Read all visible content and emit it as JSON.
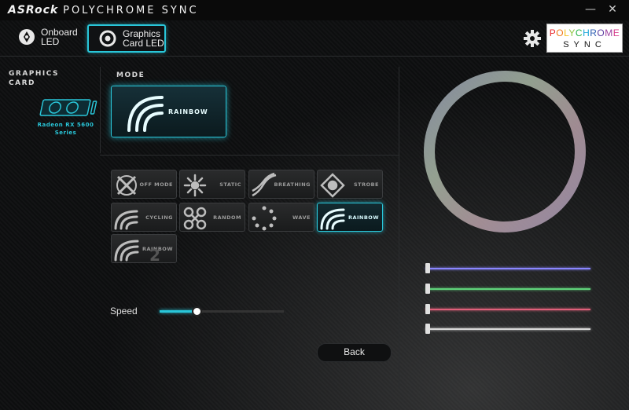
{
  "window": {
    "title_brand": "ASRock",
    "title_product": "POLYCHROME SYNC",
    "minimize_glyph": "—",
    "close_glyph": "✕"
  },
  "tabs": [
    {
      "label": "Onboard\nLED",
      "icon": "motherboard-icon",
      "active": false
    },
    {
      "label": "Graphics\nCard LED",
      "icon": "graphics-card-icon",
      "active": true
    }
  ],
  "logo": {
    "line1_colored": [
      "P",
      "O",
      "L",
      "Y",
      "C",
      "H",
      "R",
      "O",
      "M",
      "E"
    ],
    "line2": "SYNC",
    "letter_colors": [
      "#e8262a",
      "#f07a1a",
      "#f4c01c",
      "#8cc63f",
      "#29b34a",
      "#1aa7d9",
      "#2f5fb3",
      "#5a3ea0",
      "#9b3ea0",
      "#d63a8a"
    ]
  },
  "sidebar": {
    "section_label": "GRAPHICS CARD",
    "card_name": "Radeon RX 5600 Series",
    "card_icon": "graphics-card-icon"
  },
  "mode": {
    "section_label": "MODE",
    "current": "RAINBOW",
    "buttons": [
      {
        "label": "OFF MODE",
        "icon": "off-mode-icon",
        "active": false
      },
      {
        "label": "STATIC",
        "icon": "static-icon",
        "active": false
      },
      {
        "label": "BREATHING",
        "icon": "breathing-icon",
        "active": false
      },
      {
        "label": "STROBE",
        "icon": "strobe-icon",
        "active": false
      },
      {
        "label": "CYCLING",
        "icon": "cycling-icon",
        "active": false
      },
      {
        "label": "RANDOM",
        "icon": "random-icon",
        "active": false
      },
      {
        "label": "WAVE",
        "icon": "wave-icon",
        "active": false
      },
      {
        "label": "RAINBOW",
        "icon": "rainbow-icon",
        "active": true
      },
      {
        "label": "RAINBOW",
        "icon": "rainbow-2-icon",
        "active": false
      }
    ]
  },
  "speed": {
    "label": "Speed",
    "value_fraction": 0.3
  },
  "back_button": {
    "label": "Back"
  },
  "color_sliders": [
    {
      "name": "purple",
      "color": "#8a86ff",
      "value_fraction": 0.0
    },
    {
      "name": "green",
      "color": "#5fd27a",
      "value_fraction": 0.0
    },
    {
      "name": "red",
      "color": "#e0607a",
      "value_fraction": 0.0
    },
    {
      "name": "white",
      "color": "#d8d8d8",
      "value_fraction": 0.0
    }
  ],
  "colors": {
    "accent": "#29c6d9"
  }
}
